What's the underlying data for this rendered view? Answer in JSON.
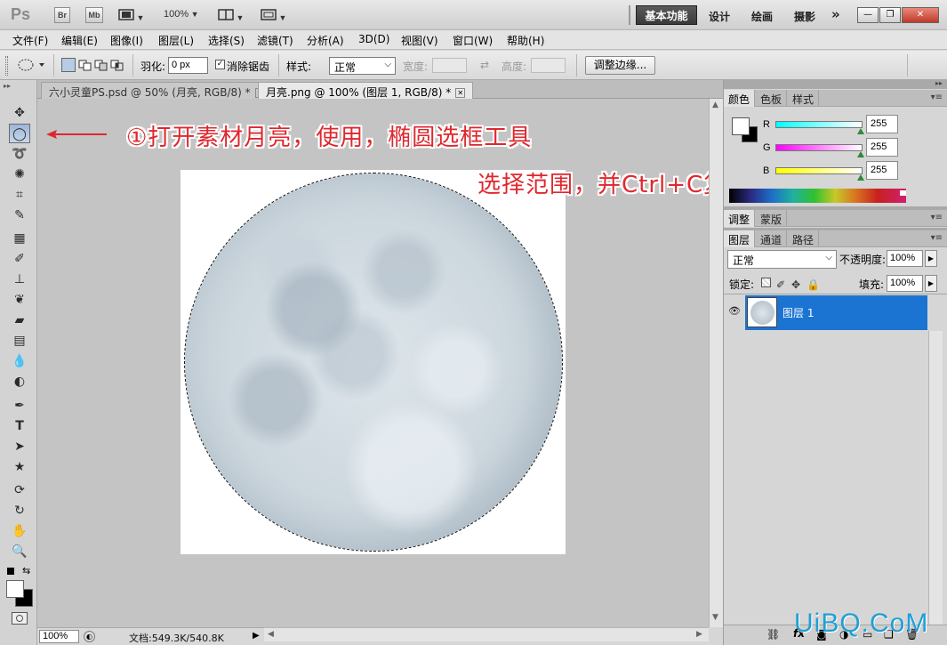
{
  "app": {
    "logo": "Ps",
    "bridge_label": "Br",
    "minibridge_label": "Mb",
    "zoom_label": "100%",
    "workspaces": {
      "active": "基本功能",
      "design": "设计",
      "paint": "绘画",
      "photo": "摄影",
      "more": "»"
    }
  },
  "menu": [
    "文件(F)",
    "编辑(E)",
    "图像(I)",
    "图层(L)",
    "选择(S)",
    "滤镜(T)",
    "分析(A)",
    "3D(D)",
    "视图(V)",
    "窗口(W)",
    "帮助(H)"
  ],
  "options": {
    "feather_label": "羽化:",
    "feather_value": "0 px",
    "antialias_label": "消除锯齿",
    "antialias_checked": true,
    "style_label": "样式:",
    "style_value": "正常",
    "width_label": "宽度:",
    "height_label": "高度:",
    "refine_edge_label": "调整边缘..."
  },
  "doc_tabs": [
    {
      "label": "六小灵童PS.psd @ 50% (月亮, RGB/8) *",
      "active": false
    },
    {
      "label": "月亮.png @ 100% (图层 1, RGB/8) *",
      "active": true
    }
  ],
  "annotations": {
    "step1": "①打开素材月亮，使用，椭圆选框工具",
    "step2": "选择范围，并Ctrl+C复制"
  },
  "status": {
    "zoom": "100%",
    "doc_info": "文档:549.3K/540.8K"
  },
  "color_panel": {
    "tabs": [
      "颜色",
      "色板",
      "样式"
    ],
    "r_label": "R",
    "g_label": "G",
    "b_label": "B",
    "r_value": "255",
    "g_value": "255",
    "b_value": "255",
    "foreground": "#ffffff",
    "background": "#000000"
  },
  "adjust_panel": {
    "tabs": [
      "调整",
      "蒙版"
    ]
  },
  "layers_panel": {
    "tabs": [
      "图层",
      "通道",
      "路径"
    ],
    "blend_mode": "正常",
    "opacity_label": "不透明度:",
    "opacity_value": "100%",
    "lock_label": "锁定:",
    "fill_label": "填充:",
    "fill_value": "100%",
    "layers": [
      {
        "name": "图层 1",
        "selected": true,
        "visible": true
      }
    ]
  },
  "watermark": "UiBQ.CoM",
  "colors": {
    "selection_blue": "#1b74d2",
    "annotation_red": "#e0272e",
    "canvas_gray": "#c4c4c4"
  }
}
